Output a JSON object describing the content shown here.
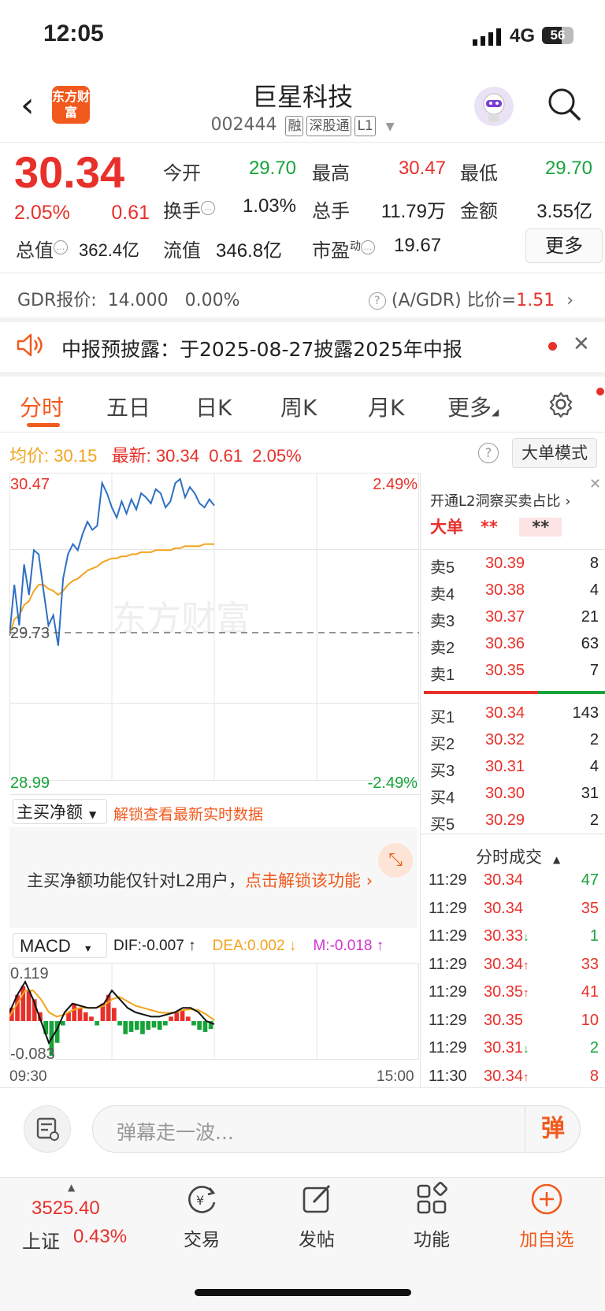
{
  "status": {
    "time": "12:05",
    "network": "4G",
    "battery": "56"
  },
  "header": {
    "title": "巨星科技",
    "code": "002444",
    "tags": [
      "融",
      "深股通",
      "L1"
    ],
    "logo_text": "东方财富"
  },
  "quote": {
    "price": "30.34",
    "pct": "2.05%",
    "chg": "0.61",
    "open_label": "今开",
    "open": "29.70",
    "high_label": "最高",
    "high": "30.47",
    "low_label": "最低",
    "low": "29.70",
    "turnover_label": "换手",
    "turnover": "1.03%",
    "volume_label": "总手",
    "volume": "11.79万",
    "amount_label": "金额",
    "amount": "3.55亿",
    "total_mv_label": "总值",
    "total_mv": "362.4亿",
    "float_mv_label": "流值",
    "float_mv": "346.8亿",
    "pe_label": "市盈",
    "pe_sup": "动",
    "pe": "19.67",
    "more_button": "更多"
  },
  "gdr": {
    "label": "GDR报价:",
    "price": "14.000",
    "pct": "0.00%",
    "ratio_label": "(A/GDR) 比价=",
    "ratio": "1.51"
  },
  "notice": {
    "text": "中报预披露：于2025-08-27披露2025年中报"
  },
  "tabs": [
    "分时",
    "五日",
    "日K",
    "周K",
    "月K",
    "更多"
  ],
  "avg_row": {
    "avg_label": "均价:",
    "avg": "30.15",
    "latest_label": "最新:",
    "latest": "30.34",
    "chg": "0.61",
    "pct": "2.05%",
    "big_mode": "大单模式"
  },
  "chart_data": [
    {
      "type": "line",
      "title": "",
      "x": [
        "09:30",
        "15:00"
      ],
      "ylim": [
        28.99,
        30.47
      ],
      "pct_range": [
        "2.49%",
        "-2.49%"
      ],
      "prev_close": "29.73",
      "y_labels": [
        "30.47",
        "29.73",
        "28.99"
      ],
      "series": [
        {
          "values": [
            29.7,
            29.95,
            29.75,
            30.05,
            29.9,
            30.12,
            30.1,
            29.92,
            29.75,
            29.8,
            29.65,
            29.98,
            30.1,
            30.15,
            30.12,
            30.2,
            30.26,
            30.22,
            30.24,
            30.45,
            30.4,
            30.33,
            30.28,
            30.36,
            30.3,
            30.37,
            30.32,
            30.4,
            30.38,
            30.35,
            30.42,
            30.4,
            30.33,
            30.36,
            30.45,
            30.47,
            30.38,
            30.43,
            30.4,
            30.35,
            30.33,
            30.37,
            30.34
          ]
        },
        {
          "values": [
            29.7,
            29.78,
            29.8,
            29.85,
            29.87,
            29.92,
            29.95,
            29.95,
            29.93,
            29.92,
            29.9,
            29.92,
            29.95,
            29.97,
            29.98,
            30.0,
            30.02,
            30.03,
            30.04,
            30.06,
            30.07,
            30.08,
            30.08,
            30.09,
            30.09,
            30.1,
            30.1,
            30.11,
            30.11,
            30.11,
            30.12,
            30.12,
            30.12,
            30.12,
            30.13,
            30.13,
            30.14,
            30.14,
            30.14,
            30.14,
            30.15,
            30.15,
            30.15
          ]
        }
      ]
    },
    {
      "type": "bar",
      "title": "MACD",
      "ylim": [
        -0.083,
        0.119
      ],
      "y_labels": [
        "0.119",
        "-0.083"
      ],
      "values": [
        0.03,
        0.06,
        0.08,
        0.07,
        0.05,
        0.02,
        -0.03,
        -0.08,
        -0.05,
        -0.01,
        0.02,
        0.04,
        0.03,
        0.02,
        0.01,
        -0.01,
        0.04,
        0.06,
        0.03,
        -0.01,
        -0.03,
        -0.025,
        -0.02,
        -0.03,
        -0.02,
        -0.015,
        -0.02,
        -0.01,
        0.01,
        0.02,
        0.025,
        0.01,
        -0.01,
        -0.02,
        -0.025,
        -0.018
      ],
      "series": [
        {
          "name": "DIF",
          "values": [
            0.02,
            0.06,
            0.09,
            0.05,
            0.0,
            -0.05,
            -0.02,
            0.02,
            0.04,
            0.035,
            0.03,
            0.03,
            0.04,
            0.07,
            0.05,
            0.03,
            0.02,
            0.015,
            0.01,
            0.01,
            0.015,
            0.02,
            0.03,
            0.03,
            0.02,
            0.0,
            -0.007
          ]
        },
        {
          "name": "DEA",
          "values": [
            0.01,
            0.04,
            0.07,
            0.07,
            0.05,
            0.02,
            0.01,
            0.015,
            0.025,
            0.03,
            0.03,
            0.03,
            0.035,
            0.05,
            0.055,
            0.045,
            0.035,
            0.03,
            0.025,
            0.02,
            0.018,
            0.02,
            0.025,
            0.027,
            0.025,
            0.015,
            0.002
          ]
        }
      ]
    }
  ],
  "orderbook": {
    "title": "开通L2洞察买卖占比",
    "big_label": "大单",
    "big_mask": "**",
    "sells": [
      {
        "name": "卖5",
        "price": "30.39",
        "vol": "8"
      },
      {
        "name": "卖4",
        "price": "30.38",
        "vol": "4"
      },
      {
        "name": "卖3",
        "price": "30.37",
        "vol": "21"
      },
      {
        "name": "卖2",
        "price": "30.36",
        "vol": "63"
      },
      {
        "name": "卖1",
        "price": "30.35",
        "vol": "7"
      }
    ],
    "buys": [
      {
        "name": "买1",
        "price": "30.34",
        "vol": "143"
      },
      {
        "name": "买2",
        "price": "30.32",
        "vol": "2"
      },
      {
        "name": "买3",
        "price": "30.31",
        "vol": "4"
      },
      {
        "name": "买4",
        "price": "30.30",
        "vol": "31"
      },
      {
        "name": "买5",
        "price": "30.29",
        "vol": "2"
      }
    ]
  },
  "ticks": {
    "title": "分时成交",
    "rows": [
      {
        "time": "11:29",
        "price": "30.34",
        "arrow": "",
        "vol": "47",
        "color": "green"
      },
      {
        "time": "11:29",
        "price": "30.34",
        "arrow": "",
        "vol": "35",
        "color": "red"
      },
      {
        "time": "11:29",
        "price": "30.33",
        "arrow": "↓",
        "vol": "1",
        "color": "green"
      },
      {
        "time": "11:29",
        "price": "30.34",
        "arrow": "↑",
        "vol": "33",
        "color": "red"
      },
      {
        "time": "11:29",
        "price": "30.35",
        "arrow": "↑",
        "vol": "41",
        "color": "red"
      },
      {
        "time": "11:29",
        "price": "30.35",
        "arrow": "",
        "vol": "10",
        "color": "red"
      },
      {
        "time": "11:29",
        "price": "30.31",
        "arrow": "↓",
        "vol": "2",
        "color": "green"
      },
      {
        "time": "11:30",
        "price": "30.34",
        "arrow": "↑",
        "vol": "8",
        "color": "red"
      }
    ]
  },
  "netbuy": {
    "select": "主买净额",
    "unlock": "解锁查看最新实时数据",
    "msg": "主买净额功能仅针对L2用户，",
    "msg_link": "点击解锁该功能"
  },
  "macd": {
    "select": "MACD",
    "dif": "DIF:-0.007 ↑",
    "dea": "DEA:0.002 ↓",
    "m": "M:-0.018 ↑"
  },
  "barrage": {
    "placeholder": "弹幕走一波...",
    "button": "弹"
  },
  "bottom_nav": {
    "index_value": "3525.40",
    "index_name": "上证",
    "index_pct": "0.43%",
    "items": [
      "交易",
      "发帖",
      "功能",
      "加自选"
    ]
  },
  "colors": {
    "accent": "#f25a1d",
    "up": "#e8302a",
    "down": "#17a33a",
    "avg": "#f3a31d",
    "price_line": "#2e6fc4"
  }
}
